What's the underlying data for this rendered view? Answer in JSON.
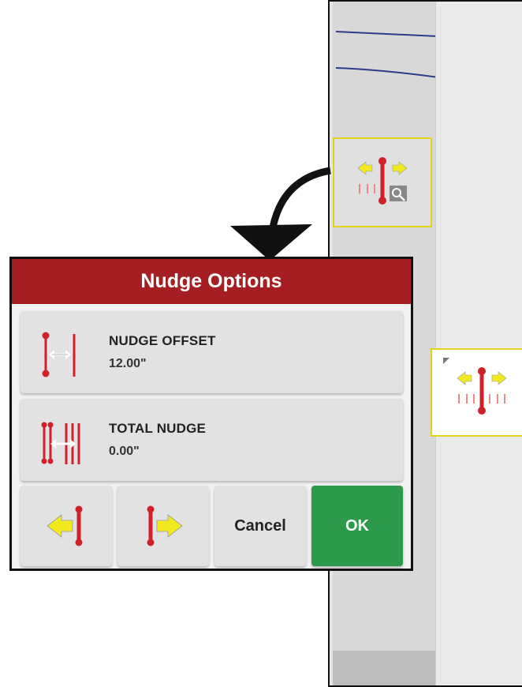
{
  "dialog": {
    "title": "Nudge Options",
    "options": [
      {
        "label": "NUDGE OFFSET",
        "value": "12.00\"",
        "icon": "nudge-offset-icon"
      },
      {
        "label": "TOTAL NUDGE",
        "value": "0.00\"",
        "icon": "total-nudge-icon"
      }
    ],
    "buttons": {
      "nudge_left_icon": "nudge-left-icon",
      "nudge_right_icon": "nudge-right-icon",
      "cancel": "Cancel",
      "ok": "OK"
    }
  },
  "colors": {
    "header_red": "#a51e22",
    "ok_green": "#2c9a48",
    "highlight_yellow": "#e2d21a",
    "arrow_yellow": "#f2e820",
    "guide_red": "#d0202a"
  }
}
